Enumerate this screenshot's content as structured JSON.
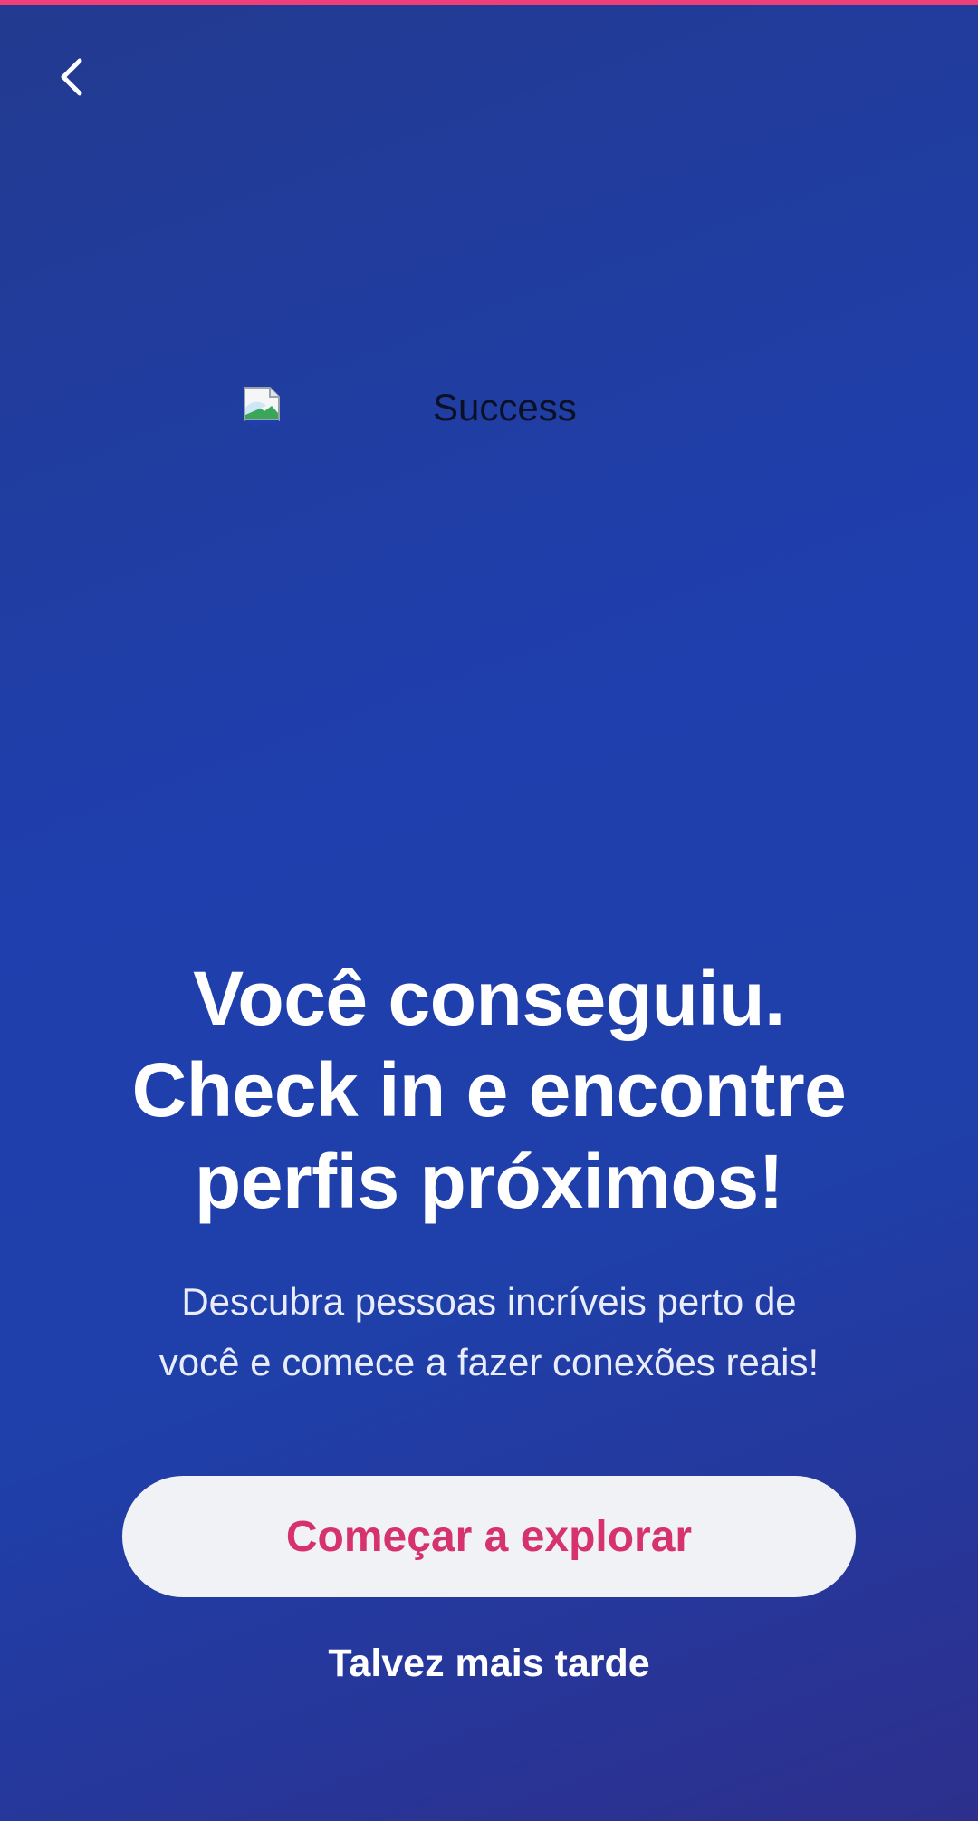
{
  "header": {
    "back_icon": "chevron-left-icon"
  },
  "hero_image": {
    "alt": "Success",
    "icon": "broken-image-icon"
  },
  "headline": {
    "line1": "Você conseguiu.",
    "line2": "Check in e encontre",
    "line3": "perfis próximos!"
  },
  "subtitle": {
    "line1": "Descubra pessoas incríveis perto de",
    "line2": "você e comece a fazer conexões reais!"
  },
  "actions": {
    "primary_label": "Começar a explorar",
    "secondary_label": "Talvez mais tarde"
  },
  "colors": {
    "accent_bar": "#ee3f79",
    "primary_text": "#d6336c",
    "button_bg": "#f1f2f6",
    "background_start": "#223a8f",
    "background_end": "#2d2f8c"
  }
}
